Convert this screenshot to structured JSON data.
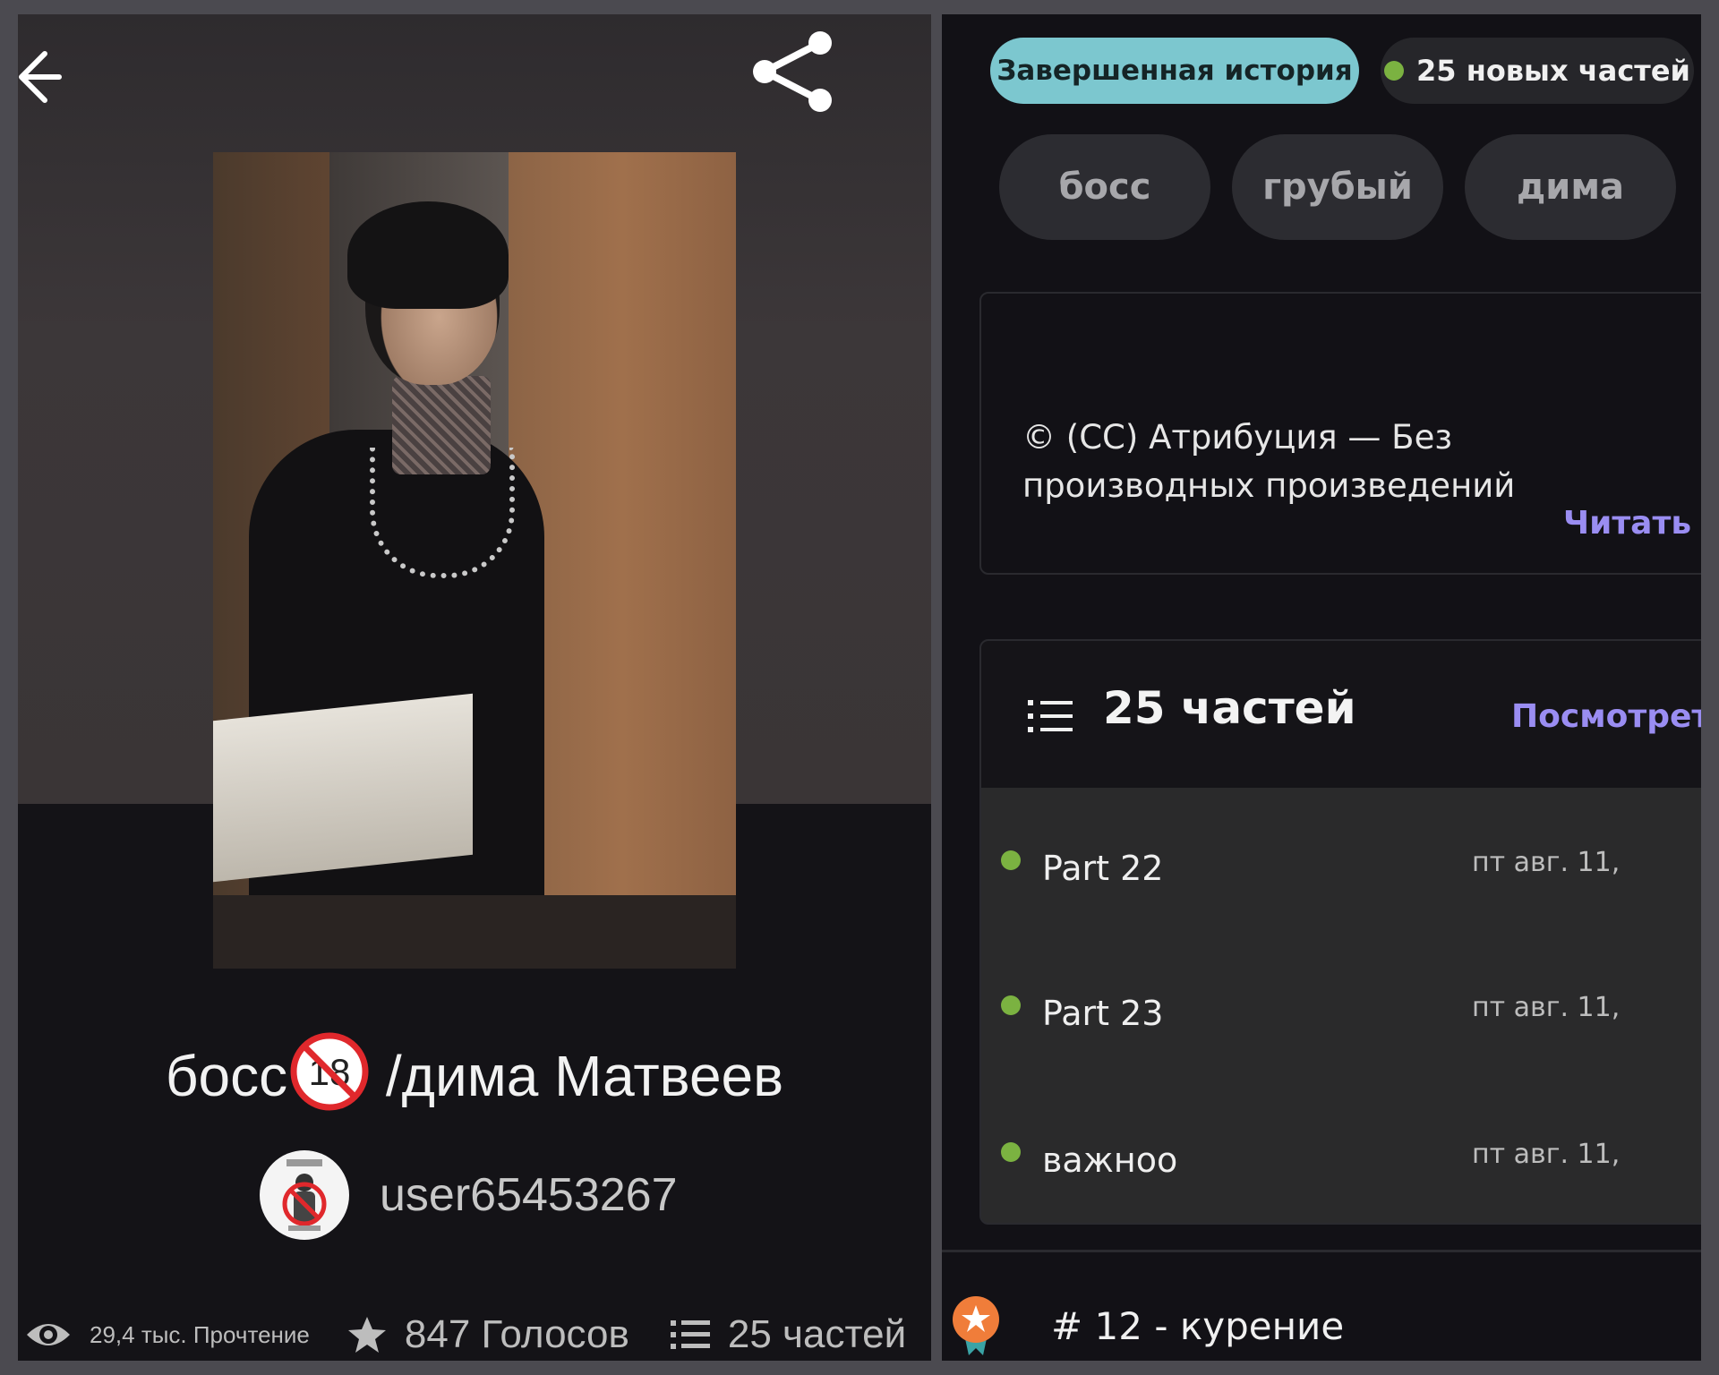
{
  "left": {
    "title": "босс",
    "title_badge": "18",
    "title_rest": " /дима Матвеев",
    "author": "user65453267",
    "stats": {
      "reads": "29,4 тыс. Прочтение",
      "votes": "847 Голосов",
      "parts": "25 частей"
    },
    "icons": [
      "back-arrow-icon",
      "share-icon",
      "eye-icon",
      "star-icon",
      "list-icon"
    ]
  },
  "right": {
    "status": "Завершенная история",
    "new_parts": "25 новых частей",
    "tags": [
      "босс",
      "грубый",
      "дима"
    ],
    "license": "© (CC) Атрибуция — Без производных произведений",
    "read_more": "Читать д",
    "parts_header": {
      "title": "25 частей",
      "view_all": "Посмотрет"
    },
    "parts": [
      {
        "name": "Part 22",
        "date": "пт авг. 11,"
      },
      {
        "name": "Part 23",
        "date": "пт авг. 11,"
      },
      {
        "name": "важноо",
        "date": "пт авг. 11,"
      }
    ],
    "ranking": "# 12 - курение"
  },
  "colors": {
    "accent_teal": "#7cc7cf",
    "accent_purple": "#9a8df2",
    "new_dot_green": "#7bb241",
    "ranking_orange": "#f07d3a"
  }
}
